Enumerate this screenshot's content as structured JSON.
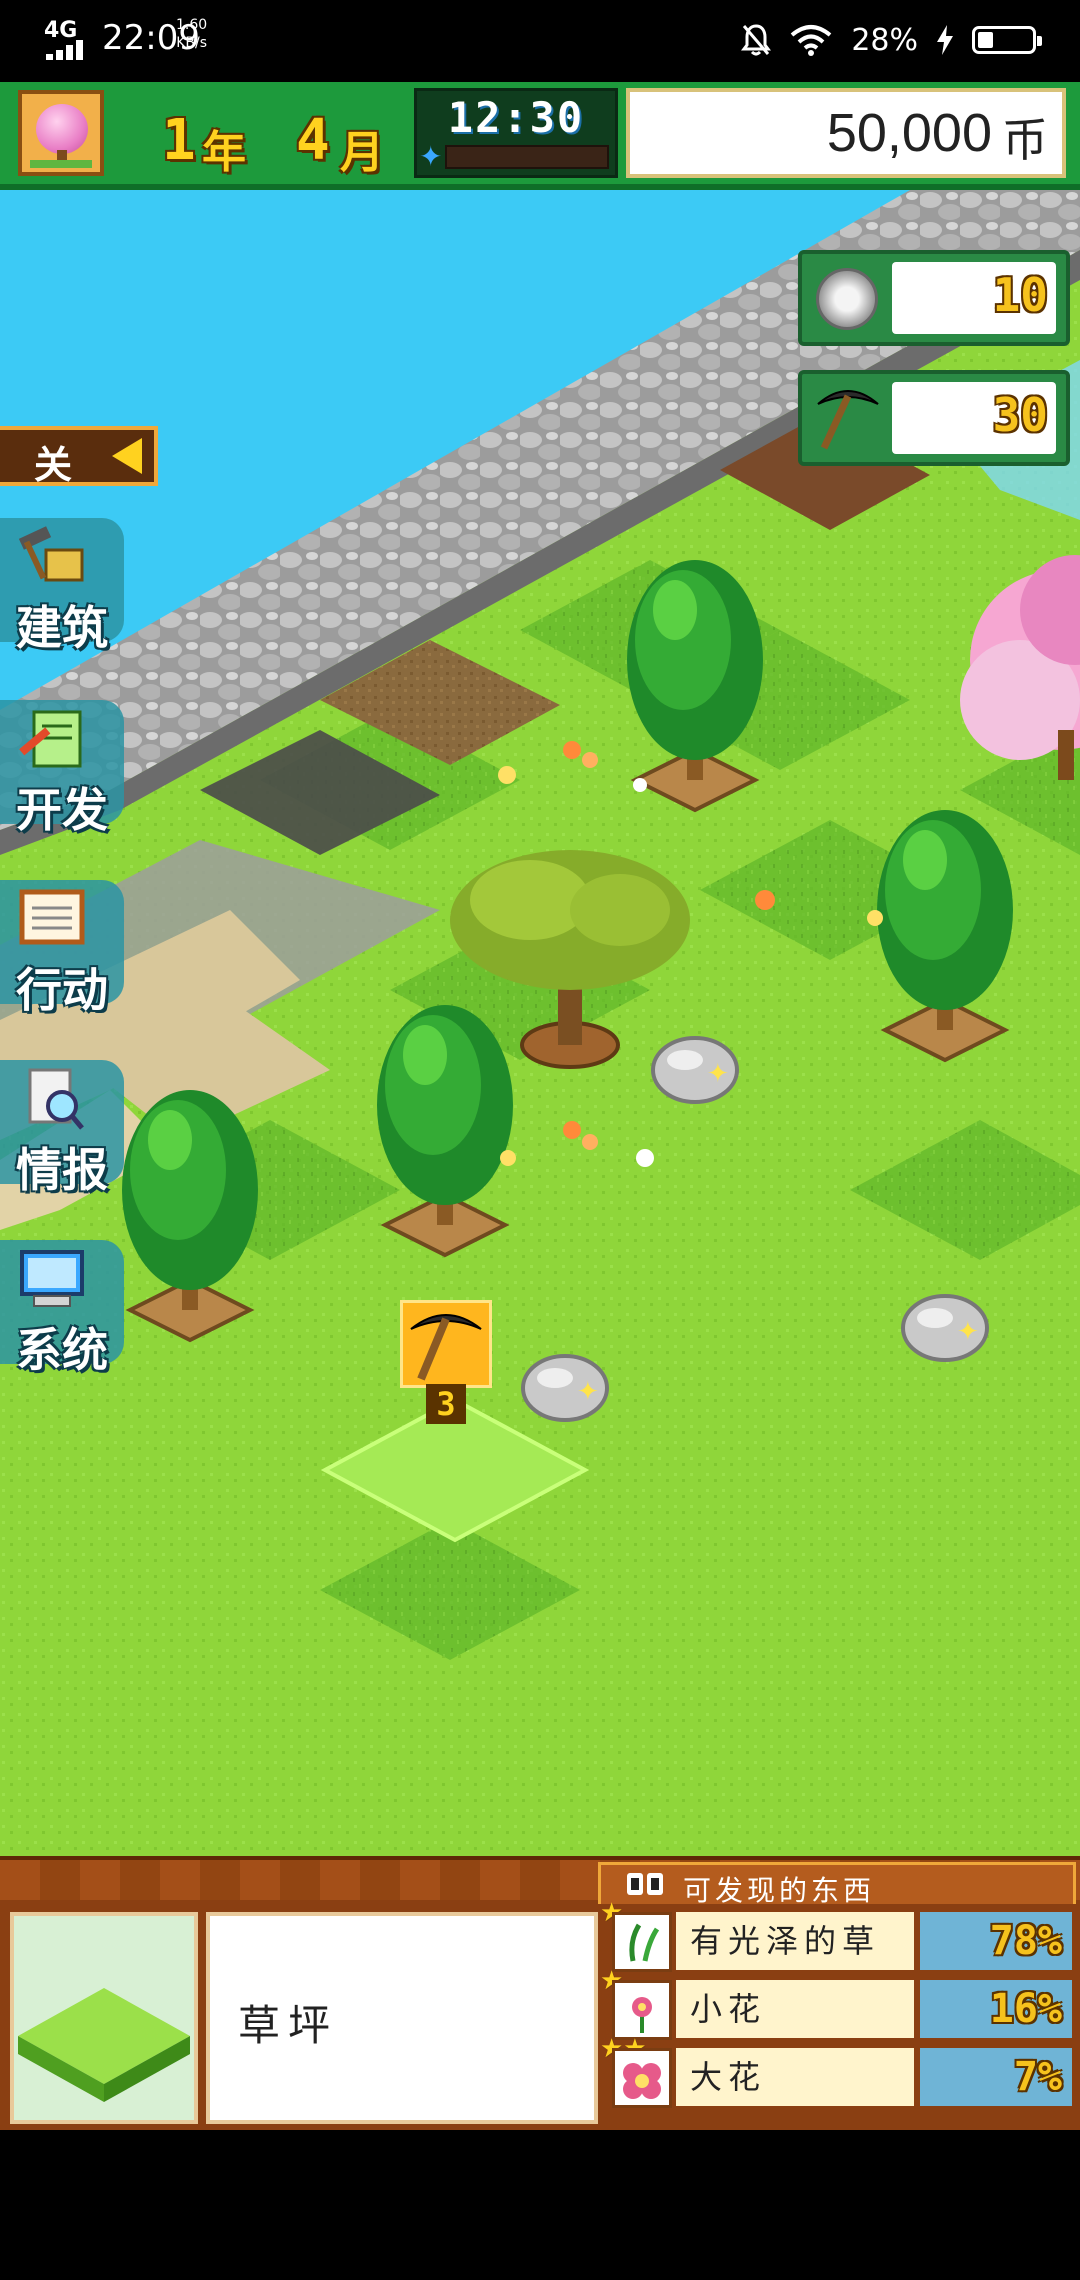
{
  "status_bar": {
    "network": "4G",
    "time": "22:09",
    "speed_value": "1.60",
    "speed_unit": "KB/s",
    "battery": "28%",
    "battery_level": 0.28
  },
  "hud": {
    "year_num": "1",
    "year_label": "年",
    "month_num": "4",
    "month_label": "月",
    "clock": "12:30",
    "money": "50,000",
    "currency": "币"
  },
  "menu": {
    "close_label": "关",
    "items": [
      {
        "label": "建筑"
      },
      {
        "label": "开发"
      },
      {
        "label": "行动"
      },
      {
        "label": "情报"
      },
      {
        "label": "系统"
      }
    ]
  },
  "counters": {
    "medals": "10",
    "pickaxes": "30"
  },
  "action": {
    "pickaxe_uses": "3"
  },
  "info_panel": {
    "discoverable_title": "可发现的东西",
    "tile_name": "草坪",
    "items": [
      {
        "name": "有光泽的草",
        "percent": "78",
        "pct_unit": "%",
        "stars": "★"
      },
      {
        "name": "小花",
        "percent": "16",
        "pct_unit": "%",
        "stars": "★"
      },
      {
        "name": "大花",
        "percent": "7",
        "pct_unit": "%",
        "stars": "★★"
      }
    ]
  },
  "colors": {
    "hud_green": "#1d9a3c",
    "grass": "#8fd63a",
    "water": "#2fc3f0",
    "panel_brown": "#8a3f12",
    "gold": "#ffd21f"
  }
}
